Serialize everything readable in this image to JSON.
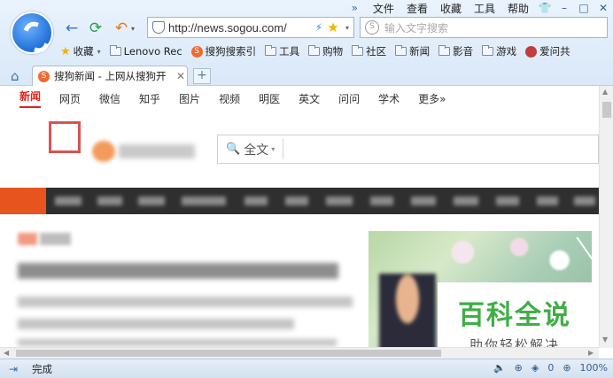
{
  "menu": {
    "overflow": "»",
    "items": [
      "文件",
      "查看",
      "收藏",
      "工具",
      "帮助"
    ],
    "window_buttons": [
      "👕",
      "–",
      "□",
      "✕"
    ]
  },
  "nav_glyphs": {
    "back": "←",
    "refresh": "⟳",
    "undo": "↶",
    "caret": "▾"
  },
  "address_bar": {
    "url": "http://news.sogou.com/",
    "bolt": "⚡",
    "star": "★",
    "caret": "▾"
  },
  "search_bar": {
    "icon_letter": "S",
    "placeholder": "输入文字搜索"
  },
  "bookmarks": [
    {
      "label": "收藏",
      "icon": "star"
    },
    {
      "label": "Lenovo Rec",
      "icon": "folder"
    },
    {
      "label": "搜狗搜索引",
      "icon": "sogou"
    },
    {
      "label": "工具",
      "icon": "folder"
    },
    {
      "label": "购物",
      "icon": "folder"
    },
    {
      "label": "社区",
      "icon": "folder"
    },
    {
      "label": "新闻",
      "icon": "folder"
    },
    {
      "label": "影音",
      "icon": "folder"
    },
    {
      "label": "游戏",
      "icon": "folder"
    },
    {
      "label": "爱问共",
      "icon": "avatar"
    }
  ],
  "tabs": {
    "home_glyph": "⌂",
    "items": [
      {
        "title": "搜狗新闻 - 上网从搜狗开",
        "icon_letter": "S",
        "close": "✕"
      }
    ],
    "new_tab": "+"
  },
  "site_nav": [
    "新闻",
    "网页",
    "微信",
    "知乎",
    "图片",
    "视频",
    "明医",
    "英文",
    "问问",
    "学术",
    "更多»"
  ],
  "site_nav_active": 0,
  "site_search": {
    "mag": "🔍",
    "scope": "全文",
    "caret": "▾"
  },
  "watermark": {
    "title": "百科全说",
    "subtitle": "助你轻松解决"
  },
  "scroll_glyphs": {
    "up": "▲",
    "down": "▼",
    "left": "◀",
    "right": "▶"
  },
  "status": {
    "sidebar": "⇥",
    "text": "完成",
    "volume": "🔈",
    "extension": "⊕",
    "shield_count": "0",
    "zoom": "100%"
  },
  "colors": {
    "accent_red": "#e2231a",
    "channel_bar": "#2f2f2f",
    "channel_hot": "#e8541e",
    "watermark_green": "#3fae45"
  }
}
